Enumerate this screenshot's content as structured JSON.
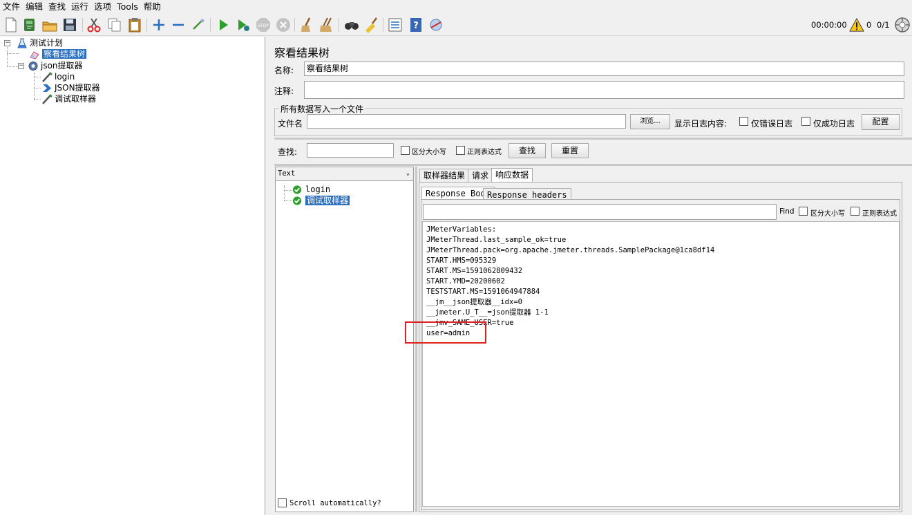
{
  "menu": [
    "文件",
    "编辑",
    "查找",
    "运行",
    "选项",
    "Tools",
    "帮助"
  ],
  "toolbar": {
    "icons": [
      "new-icon",
      "templates-icon",
      "open-icon",
      "save-icon",
      "cut-icon",
      "copy-icon",
      "paste-icon",
      "expand-icon",
      "collapse-icon",
      "toggle-icon",
      "start-icon",
      "start-no-pauses-icon",
      "stop-icon",
      "shutdown-icon",
      "clear-icon",
      "clear-all-icon",
      "search-icon",
      "reset-search-icon",
      "function-helper-icon",
      "help-icon",
      "remote-icon"
    ],
    "timer": "00:00:00",
    "warning_count": "0",
    "threads": "0/1"
  },
  "tree": {
    "nodes": [
      {
        "label": "测试计划"
      },
      {
        "label": "察看结果树"
      },
      {
        "label": "json提取器"
      },
      {
        "label": "login"
      },
      {
        "label": "JSON提取器"
      },
      {
        "label": "调试取样器"
      }
    ]
  },
  "panel": {
    "title": "察看结果树",
    "name_label": "名称:",
    "name_value": "察看结果树",
    "comment_label": "注释:",
    "comment_value": "",
    "file_group_title": "所有数据写入一个文件",
    "filename_label": "文件名",
    "filename_value": "",
    "browse_label": "浏览...",
    "log_content_label": "显示日志内容:",
    "errors_only_label": "仅错误日志",
    "success_only_label": "仅成功日志",
    "configure_label": "配置",
    "search_label": "查找:",
    "search_value": "",
    "case_sensitive_label": "区分大小写",
    "regex_label": "正则表达式",
    "search_button": "查找",
    "reset_button": "重置"
  },
  "results": {
    "renderer": "Text",
    "samples": [
      {
        "label": "login",
        "status": "success"
      },
      {
        "label": "调试取样器",
        "status": "success"
      }
    ],
    "scroll_auto_label": "Scroll automatically?",
    "tabs": [
      "取样器结果",
      "请求",
      "响应数据"
    ],
    "active_tab": "响应数据",
    "subtabs": [
      "Response Body",
      "Response headers"
    ],
    "active_subtab": "Response Body",
    "find_value": "",
    "find_label": "Find",
    "find_case_label": "区分大小写",
    "find_regex_label": "正则表达式",
    "body_lines": [
      "JMeterVariables:",
      "JMeterThread.last_sample_ok=true",
      "JMeterThread.pack=org.apache.jmeter.threads.SamplePackage@1ca8df14",
      "START.HMS=095329",
      "START.MS=1591062809432",
      "START.YMD=20200602",
      "TESTSTART.MS=1591064947884",
      "__jm__json提取器__idx=0",
      "__jmeter.U_T__=json提取器 1-1",
      "__jmv_SAME_USER=true",
      "user=admin"
    ],
    "highlight_color": "#e02020"
  }
}
